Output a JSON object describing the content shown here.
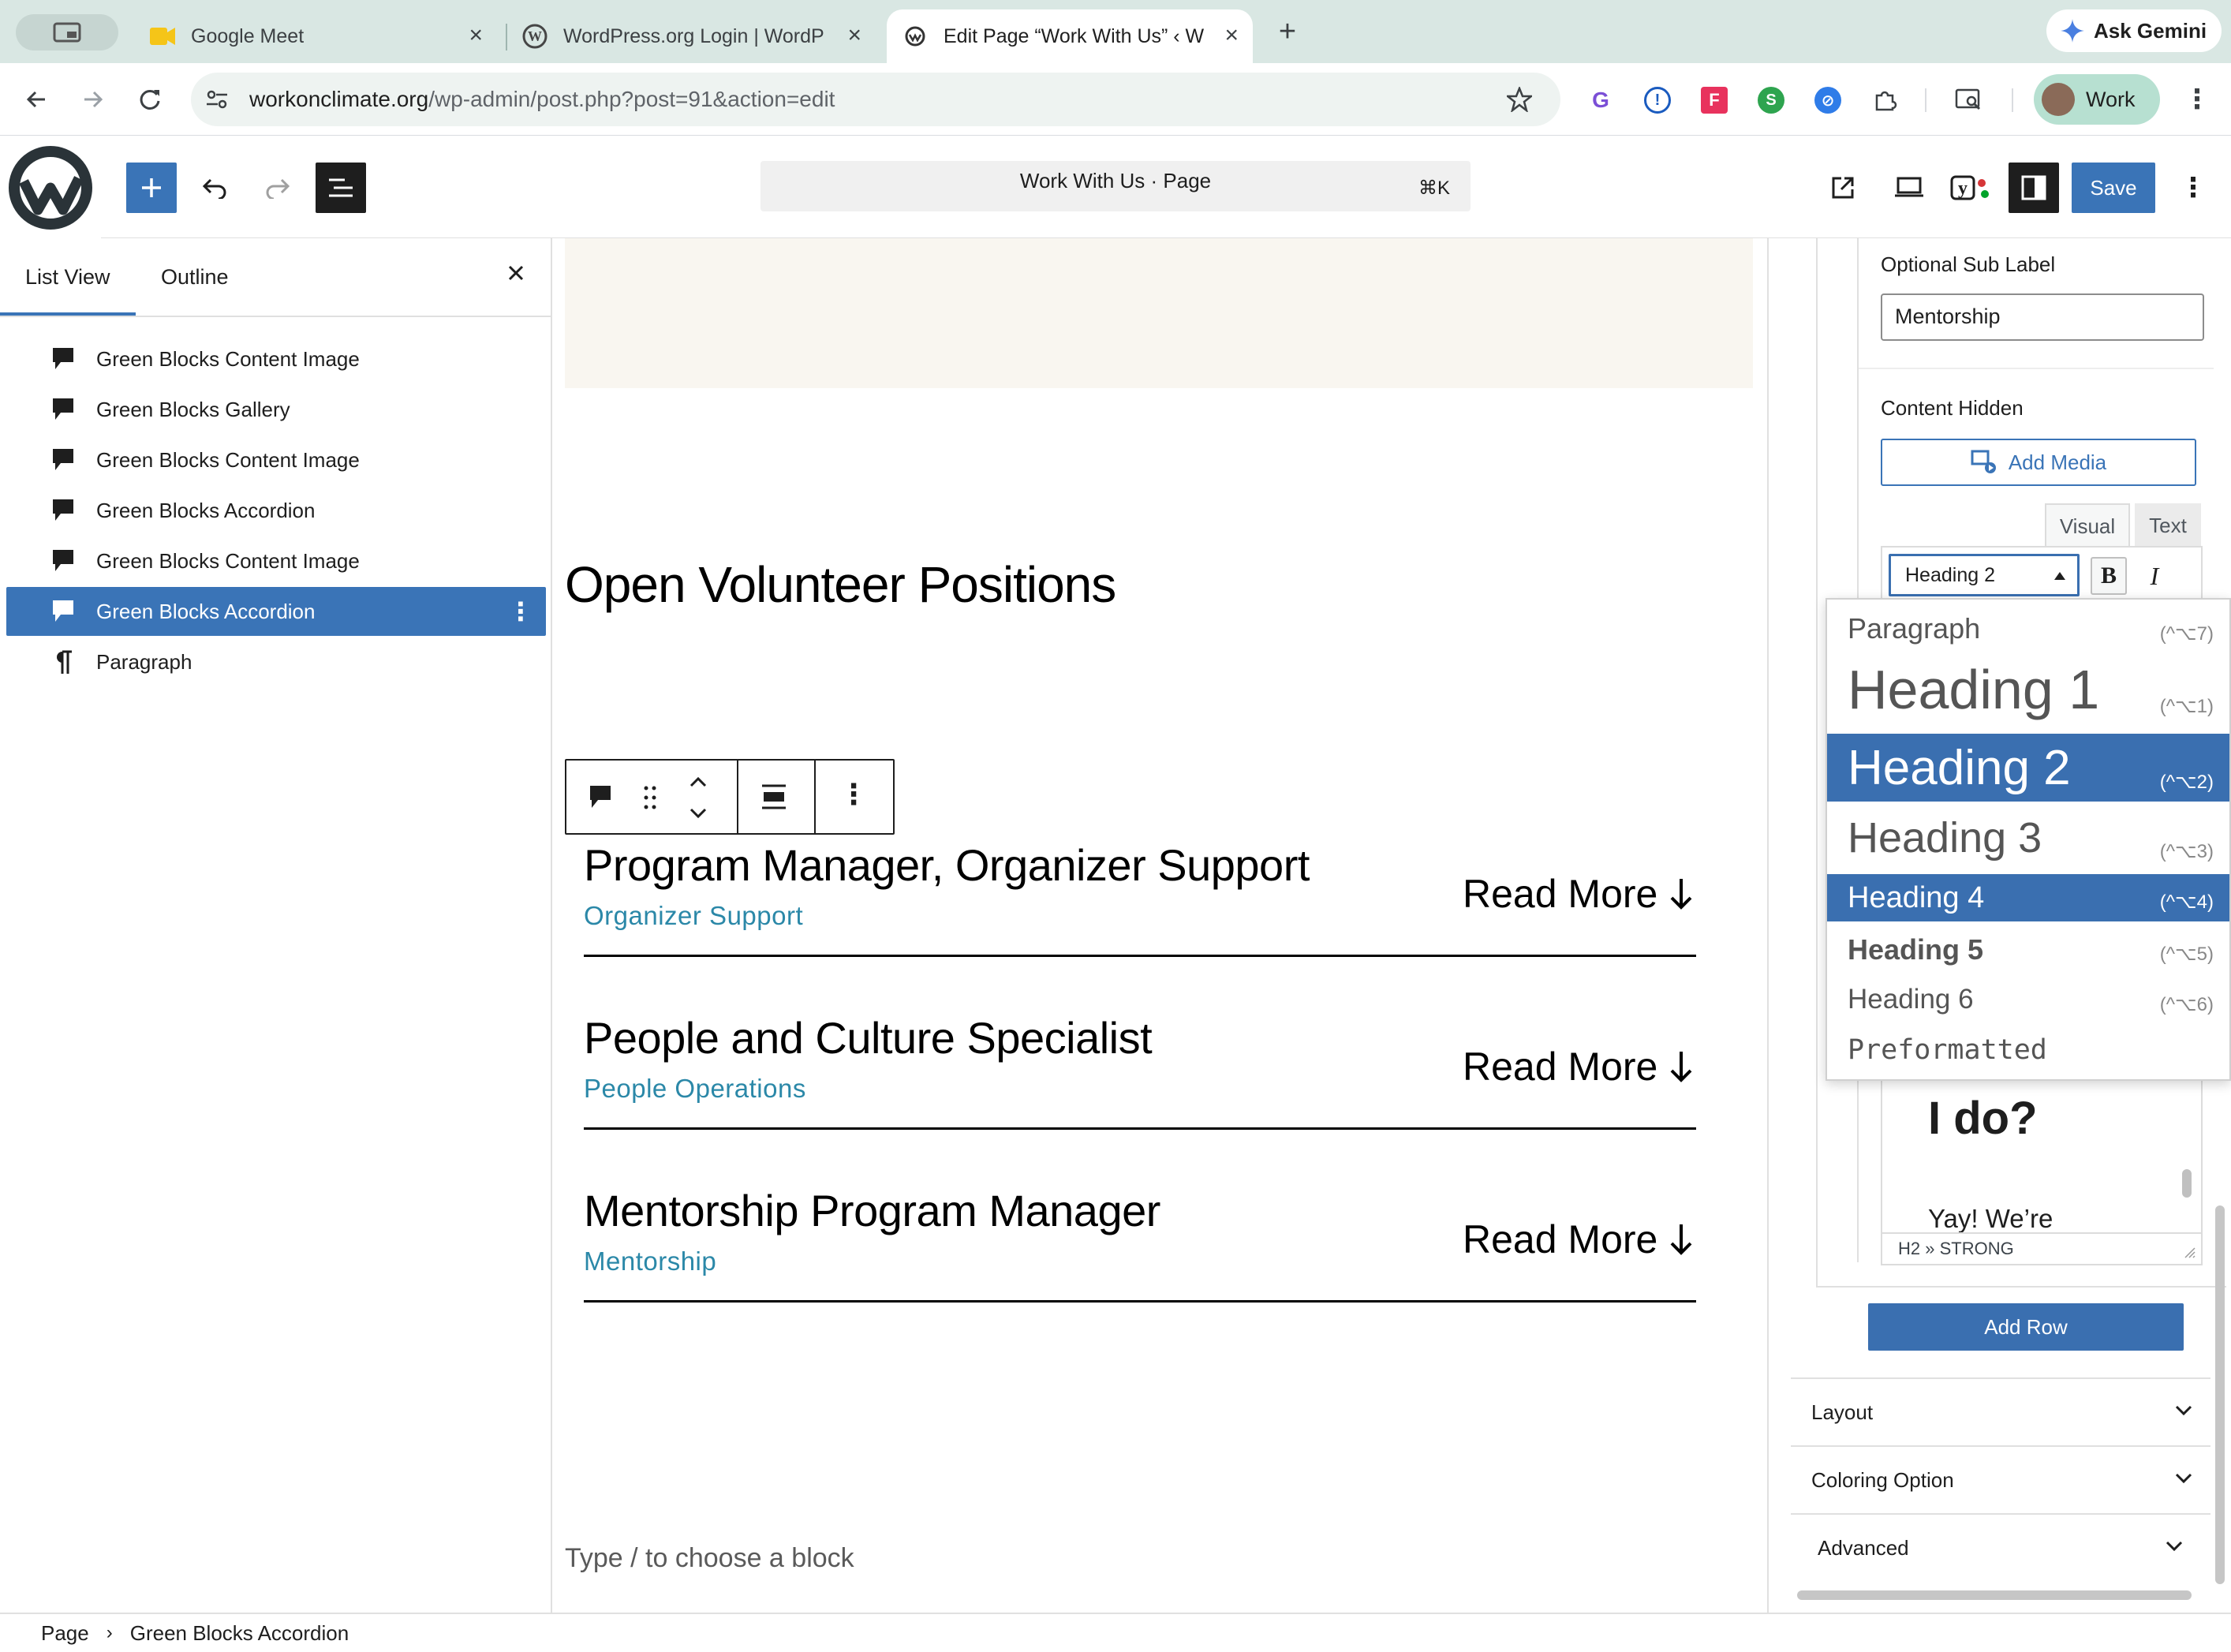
{
  "browser": {
    "tabs": [
      {
        "title": "Google Meet",
        "icon": "meet-icon"
      },
      {
        "title": "WordPress.org Login | WordP",
        "icon": "wordpress-icon"
      },
      {
        "title": "Edit Page “Work With Us” ‹ W",
        "icon": "site-icon"
      }
    ],
    "ask_gemini": "Ask Gemini",
    "url_host": "workonclimate.org",
    "url_path": "/wp-admin/post.php?post=91&action=edit",
    "profile": "Work"
  },
  "wp_header": {
    "doc_title": "Work With Us · Page",
    "shortcut": "⌘K",
    "save": "Save"
  },
  "list_view": {
    "tabs": [
      "List View",
      "Outline"
    ],
    "items": [
      {
        "label": "Green Blocks Content Image",
        "icon": "block-icon",
        "selected": false
      },
      {
        "label": "Green Blocks Gallery",
        "icon": "block-icon",
        "selected": false
      },
      {
        "label": "Green Blocks Content Image",
        "icon": "block-icon",
        "selected": false
      },
      {
        "label": "Green Blocks Accordion",
        "icon": "block-icon",
        "selected": false
      },
      {
        "label": "Green Blocks Content Image",
        "icon": "block-icon",
        "selected": false
      },
      {
        "label": "Green Blocks Accordion",
        "icon": "block-icon",
        "selected": true
      },
      {
        "label": "Paragraph",
        "icon": "paragraph-icon",
        "selected": false
      }
    ]
  },
  "canvas": {
    "heading": "Open Volunteer Positions",
    "jobs": [
      {
        "title": "Program Manager, Organizer Support",
        "sub": "Organizer Support",
        "cta": "Read More"
      },
      {
        "title": "People and Culture Specialist",
        "sub": "People Operations",
        "cta": "Read More"
      },
      {
        "title": "Mentorship Program Manager",
        "sub": "Mentorship",
        "cta": "Read More"
      }
    ],
    "placeholder": "Type / to choose a block"
  },
  "sidebar": {
    "sub_label_title": "Optional Sub Label",
    "sub_label_value": "Mentorship",
    "content_hidden": "Content Hidden",
    "add_media": "Add Media",
    "editor_tabs": [
      "Visual",
      "Text"
    ],
    "format_value": "Heading 2",
    "bold": "B",
    "italic": "I",
    "editor_text_1": "I do?",
    "editor_text_2": "Yay! We’re",
    "editor_path": "H2 » STRONG",
    "add_row": "Add Row",
    "panels": [
      "Layout",
      "Coloring Option",
      "Advanced"
    ]
  },
  "format_menu": [
    {
      "label": "Paragraph",
      "shortcut": "(^⌥7)"
    },
    {
      "label": "Heading 1",
      "shortcut": "(^⌥1)"
    },
    {
      "label": "Heading 2",
      "shortcut": "(^⌥2)"
    },
    {
      "label": "Heading 3",
      "shortcut": "(^⌥3)"
    },
    {
      "label": "Heading 4",
      "shortcut": "(^⌥4)"
    },
    {
      "label": "Heading 5",
      "shortcut": "(^⌥5)"
    },
    {
      "label": "Heading 6",
      "shortcut": "(^⌥6)"
    },
    {
      "label": "Preformatted",
      "shortcut": ""
    }
  ],
  "breadcrumb": [
    "Page",
    "Green Blocks Accordion"
  ],
  "colors": {
    "wp_blue": "#3a74b7",
    "link_teal": "#2b88a8",
    "menu_highlight": "#3a6fb0"
  }
}
